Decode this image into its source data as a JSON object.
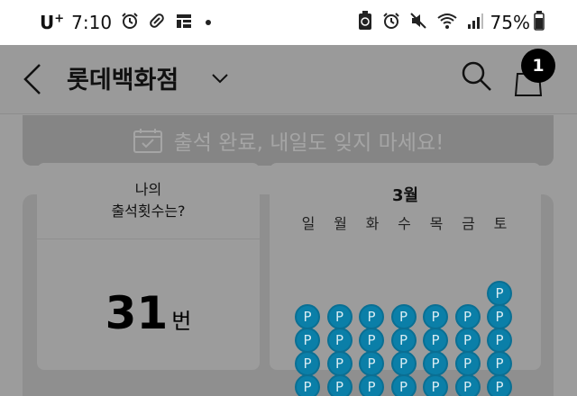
{
  "status_bar": {
    "carrier": "U",
    "carrier_sup": "+",
    "time": "7:10",
    "battery_percent": "75%",
    "icons": [
      "alarm-icon",
      "pill-icon",
      "grid-app-icon",
      "recycle-battery-icon",
      "alarm-icon",
      "mute-icon",
      "wifi-icon",
      "signal-icon",
      "battery-icon"
    ]
  },
  "header": {
    "title": "롯데백화점",
    "cart_count": "1"
  },
  "banner": {
    "text": "출석 완료, 내일도 잊지 마세요!"
  },
  "attendance": {
    "question_line1": "나의",
    "question_line2": "출석횟수는?",
    "count": "31",
    "count_unit": "번"
  },
  "calendar": {
    "month": "3월",
    "weekdays": [
      "일",
      "월",
      "화",
      "수",
      "목",
      "금",
      "토"
    ],
    "stamp_label": "P",
    "stamps_visible": 29,
    "first_day_column": 6
  },
  "colors": {
    "overlay": "#9c9c9c",
    "stamp": "#0b7fa8",
    "badge": "#000000"
  }
}
